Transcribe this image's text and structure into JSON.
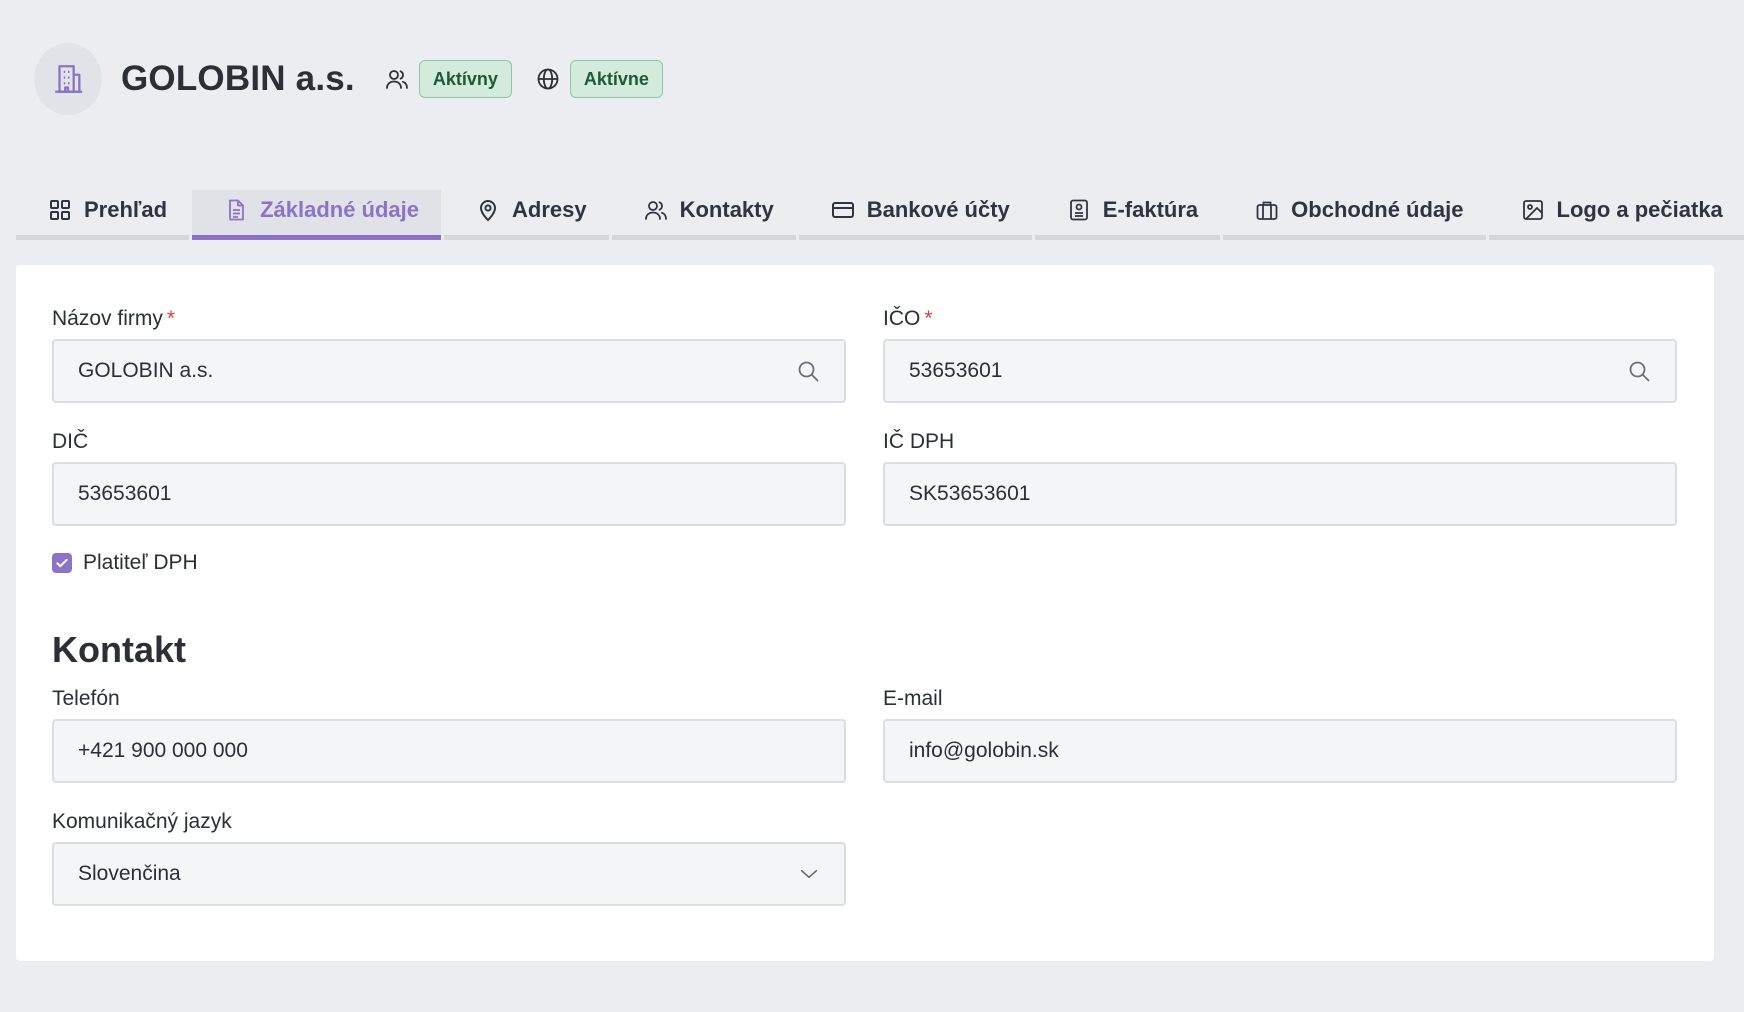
{
  "company": {
    "name": "GOLOBIN a.s.",
    "status_users": "Aktívny",
    "status_web": "Aktívne"
  },
  "tabs": [
    {
      "label": "Prehľad",
      "icon": "grid-icon",
      "active": false
    },
    {
      "label": "Základné údaje",
      "icon": "document-icon",
      "active": true
    },
    {
      "label": "Adresy",
      "icon": "map-pin-icon",
      "active": false
    },
    {
      "label": "Kontakty",
      "icon": "users-icon",
      "active": false
    },
    {
      "label": "Bankové účty",
      "icon": "credit-card-icon",
      "active": false
    },
    {
      "label": "E-faktúra",
      "icon": "invoice-icon",
      "active": false
    },
    {
      "label": "Obchodné údaje",
      "icon": "briefcase-icon",
      "active": false
    },
    {
      "label": "Logo a pečiatka",
      "icon": "image-icon",
      "active": false
    }
  ],
  "form": {
    "company_name": {
      "label": "Názov firmy",
      "required": "*",
      "value": "GOLOBIN a.s."
    },
    "ico": {
      "label": "IČO",
      "required": "*",
      "value": "53653601"
    },
    "dic": {
      "label": "DIČ",
      "value": "53653601"
    },
    "ic_dph": {
      "label": "IČ DPH",
      "value": "SK53653601"
    },
    "vat_payer": {
      "label": "Platiteľ DPH",
      "checked": true
    }
  },
  "contact": {
    "title": "Kontakt",
    "phone": {
      "label": "Telefón",
      "value": "+421 900 000 000"
    },
    "email": {
      "label": "E-mail",
      "value": "info@golobin.sk"
    },
    "language": {
      "label": "Komunikačný jazyk",
      "value": "Slovenčina"
    }
  },
  "colors": {
    "accent": "#8b73c8",
    "badge_bg": "#d3ebdd",
    "badge_text": "#1f5a38",
    "required": "#d2453a"
  }
}
